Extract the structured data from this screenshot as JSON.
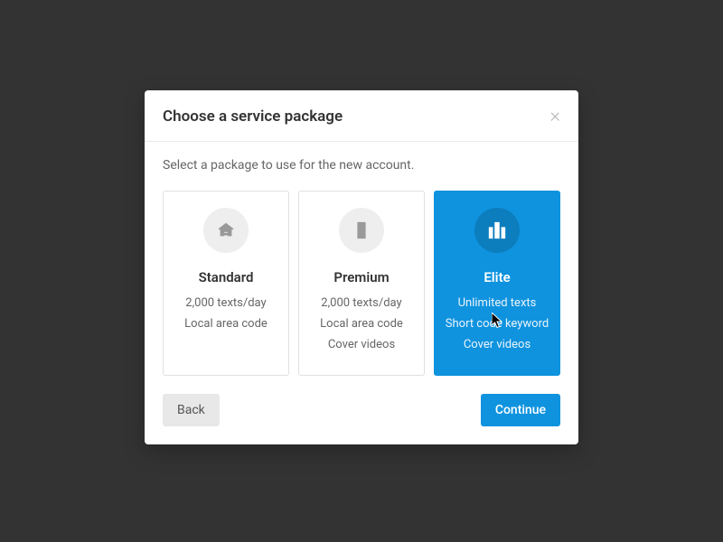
{
  "modal": {
    "title": "Choose a service package",
    "subtitle": "Select a package to use for the new account.",
    "close": "×"
  },
  "packages": [
    {
      "name": "Standard",
      "features": [
        "2,000 texts/day",
        "Local area code"
      ],
      "selected": false,
      "icon": "house"
    },
    {
      "name": "Premium",
      "features": [
        "2,000 texts/day",
        "Local area code",
        "Cover videos"
      ],
      "selected": false,
      "icon": "building"
    },
    {
      "name": "Elite",
      "features": [
        "Unlimited texts",
        "Short code keyword",
        "Cover videos"
      ],
      "selected": true,
      "icon": "city"
    }
  ],
  "buttons": {
    "back": "Back",
    "continue": "Continue"
  }
}
